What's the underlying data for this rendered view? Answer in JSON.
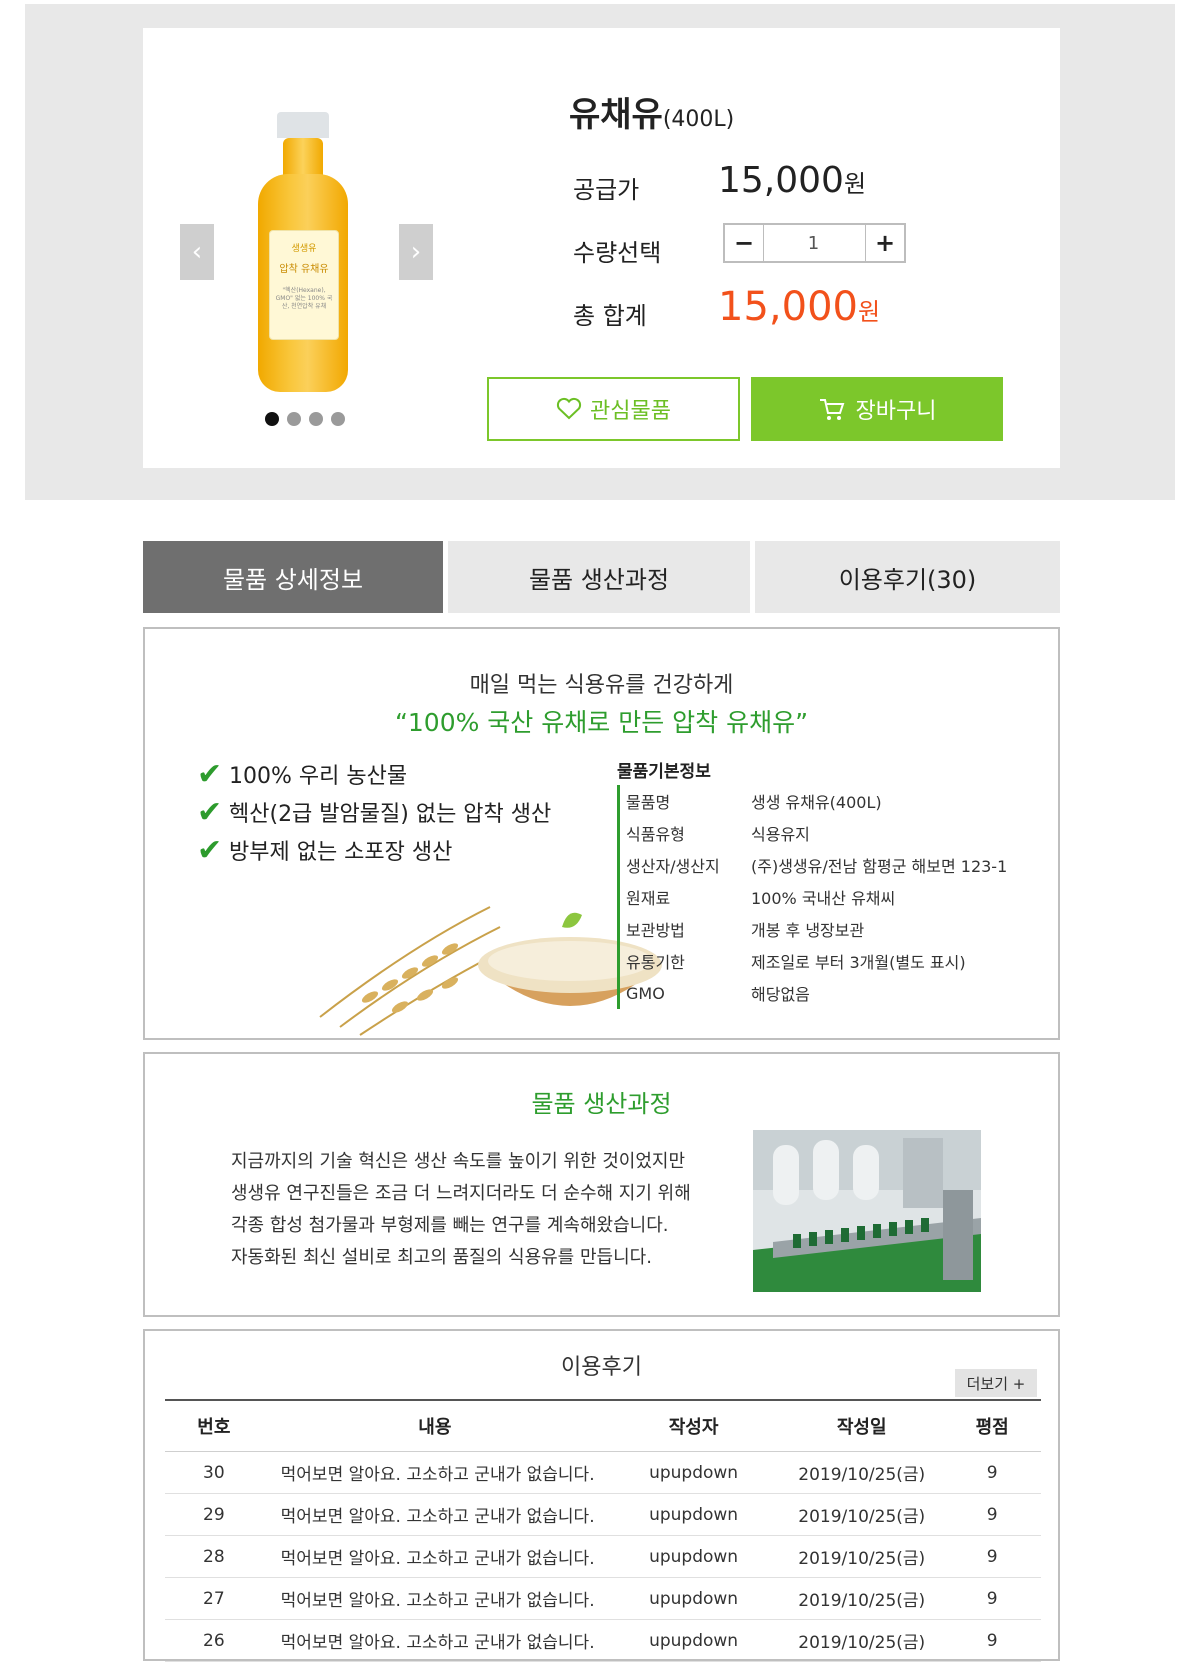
{
  "product": {
    "name": "유채유",
    "volume": "(400L)",
    "bottle_brand": "생생유",
    "bottle_name": "압착 유채유",
    "bottle_desc": "\"헥산(Hexane), GMO\" 없는 100% 국산, 천연압착 유채",
    "supply_label": "공급가",
    "supply_price": "15,000",
    "qty_label": "수량선택",
    "qty_value": "1",
    "qty_minus": "−",
    "qty_plus": "+",
    "total_label": "총 합계",
    "total_price": "15,000",
    "won": "원",
    "wish_label": "관심물품",
    "cart_label": "장바구니",
    "prev_arrow": "‹",
    "next_arrow": "›"
  },
  "tabs": [
    {
      "label": "물품 상세정보",
      "active": true
    },
    {
      "label": "물품 생산과정",
      "active": false
    },
    {
      "label": "이용후기(30)",
      "active": false
    }
  ],
  "detail": {
    "headline": "매일 먹는 식용유를 건강하게",
    "quote": "“100% 국산 유채로 만든 압착 유채유”",
    "features": [
      "100% 우리 농산물",
      "헥산(2급 발암물질) 없는 압착 생산",
      "방부제 없는 소포장 생산"
    ],
    "info_title": "물품기본정보",
    "info": [
      {
        "k": "물품명",
        "v": "생생 유채유(400L)"
      },
      {
        "k": "식품유형",
        "v": "식용유지"
      },
      {
        "k": "생산자/생산지",
        "v": "(주)생생유/전남 함평군 해보면 123-1"
      },
      {
        "k": "원재료",
        "v": "100% 국내산 유채씨"
      },
      {
        "k": "보관방법",
        "v": "개봉 후 냉장보관"
      },
      {
        "k": "유통기한",
        "v": "제조일로 부터 3개월(별도 표시)"
      },
      {
        "k": "GMO",
        "v": "해당없음"
      }
    ]
  },
  "process": {
    "title": "물품 생산과정",
    "lines": [
      "지금까지의 기술 혁신은 생산 속도를 높이기 위한 것이었지만",
      "생생유 연구진들은 조금 더 느려지더라도 더 순수해 지기 위해",
      "각종 합성 첨가물과 부형제를 빼는 연구를 계속해왔습니다.",
      "자동화된 최신 설비로 최고의 품질의 식용유를 만듭니다."
    ]
  },
  "reviews": {
    "title": "이용후기",
    "more": "더보기 +",
    "headers": [
      "번호",
      "내용",
      "작성자",
      "작성일",
      "평점"
    ],
    "rows": [
      [
        "30",
        "먹어보면 알아요. 고소하고 군내가 없습니다.",
        "upupdown",
        "2019/10/25(금)",
        "9"
      ],
      [
        "29",
        "먹어보면 알아요. 고소하고 군내가 없습니다.",
        "upupdown",
        "2019/10/25(금)",
        "9"
      ],
      [
        "28",
        "먹어보면 알아요. 고소하고 군내가 없습니다.",
        "upupdown",
        "2019/10/25(금)",
        "9"
      ],
      [
        "27",
        "먹어보면 알아요. 고소하고 군내가 없습니다.",
        "upupdown",
        "2019/10/25(금)",
        "9"
      ],
      [
        "26",
        "먹어보면 알아요. 고소하고 군내가 없습니다.",
        "upupdown",
        "2019/10/25(금)",
        "9"
      ]
    ]
  },
  "colors": {
    "accent_green": "#7cc72b",
    "price_red": "#f2511b",
    "quote_green": "#2e9d2e"
  }
}
